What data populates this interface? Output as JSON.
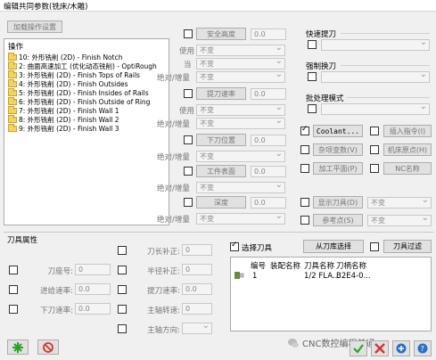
{
  "window": {
    "title": "编辑共同参数(铣床/木雕)"
  },
  "left": {
    "load_button": "加载操作设置",
    "ops_header": "操作",
    "operations": [
      "10: 外形铣削 (2D) - Finish Notch",
      "2: 曲面高速加工 (优化动态铣削) - OptiRough",
      "3: 外形铣削 (2D) - Finish Tops of Rails",
      "4: 外形铣削 (2D) - Finish Outsides",
      "5: 外形铣削 (2D) - Finish Insides of Rails",
      "6: 外形铣削 (2D) - Finish Outside of Ring",
      "7: 外形铣削 (2D) - Finish Wall 1",
      "8: 外形铣削 (2D) - Finish Wall 2",
      "9: 外形铣削 (2D) - Finish Wall 3"
    ]
  },
  "middle": {
    "safety_height": {
      "button": "安全高度",
      "value": "0.0",
      "use_label": "使用",
      "use_value": "不变",
      "current_label": "当",
      "current_value": "不变",
      "mode_label": "绝对/增量",
      "mode_value": "不变"
    },
    "retract": {
      "button": "提刀速率",
      "value": "0.0",
      "use_label": "使用",
      "use_value": "不变",
      "mode_label": "绝对/增量",
      "mode_value": "不变"
    },
    "feed_plane": {
      "button": "下刀位置",
      "value": "0.0",
      "mode_label": "绝对/增量",
      "mode_value": "不变"
    },
    "top_stock": {
      "button": "工件表面",
      "value": "0.0",
      "mode_label": "绝对/增量",
      "mode_value": "不变"
    },
    "depth": {
      "button": "深度",
      "value": "0.0",
      "mode_label": "绝对/增量",
      "mode_value": "不变"
    }
  },
  "right": {
    "rapid_retract": {
      "label": "快速提刀",
      "value": ""
    },
    "force_tool_change": {
      "label": "强制换刀",
      "value": ""
    },
    "batch_mode": {
      "label": "批处理模式",
      "value": ""
    },
    "coolant_button": "Coolant...",
    "insert_command_button": "插入指令(I)",
    "misc_values_button": "杂项变数(V)",
    "home_button": "机床原点(H)",
    "plane_button": "加工平面(P)",
    "nc_name_button": "NC名称",
    "display_tool_button": "显示刀具(D)",
    "display_tool_value": "不变",
    "ref_point_button": "参考点(S)",
    "ref_point_value": "不变"
  },
  "tool_props": {
    "title": "刀具属性",
    "tool_number_label": "刀座号:",
    "tool_number_value": "0",
    "feed_label": "进给速率:",
    "feed_value": "0.0",
    "plunge_label": "下刀速率:",
    "plunge_value": "0.0",
    "length_offset_label": "刀长补正:",
    "length_offset_value": "0",
    "radius_offset_label": "半径补正:",
    "radius_offset_value": "0",
    "retract_rate_label": "提刀速率:",
    "retract_rate_value": "0.0",
    "spindle_speed_label": "主轴转速:",
    "spindle_speed_value": "0",
    "spindle_dir_label": "主轴方向:",
    "spindle_dir_value": ""
  },
  "tool_select": {
    "select_label": "选择刀具",
    "library_button": "从刀库选择",
    "filter_button": "刀具过滤",
    "columns": [
      "编号",
      "装配名称",
      "刀具名称",
      "刀柄名称"
    ],
    "rows": [
      {
        "number": "1",
        "assembly": "",
        "tool": "1/2 FLA...",
        "holder": "B2E4-0..."
      }
    ]
  },
  "footer": {
    "watermark": "CNC数控编程普通"
  },
  "colors": {
    "confirm": "#2e9e2e",
    "cancel": "#d83232",
    "help": "#2b6fc9"
  }
}
